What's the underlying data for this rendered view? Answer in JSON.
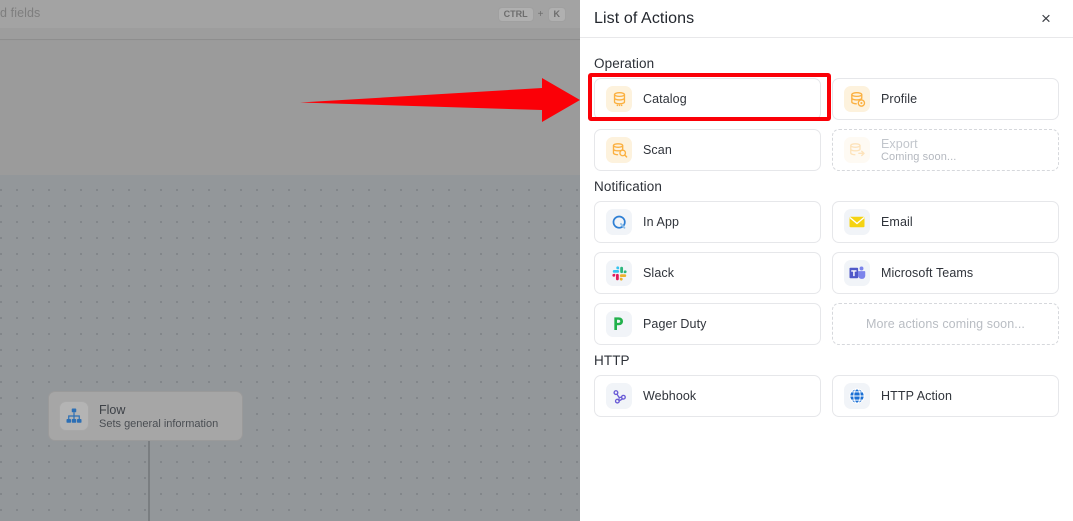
{
  "backdrop": {
    "search_text": "d fields",
    "shortcut": {
      "key1": "CTRL",
      "plus": "+",
      "key2": "K"
    },
    "flow_node": {
      "title": "Flow",
      "subtitle": "Sets general information",
      "icon": "org-chart-icon"
    }
  },
  "annotation": {
    "arrow_color": "#fb0007",
    "highlight_color": "#fb0007",
    "highlight_target": "Catalog"
  },
  "panel": {
    "title": "List of Actions",
    "close_label": "×",
    "sections": [
      {
        "id": "operation",
        "title": "Operation",
        "items": [
          {
            "label": "Catalog",
            "sub": "",
            "icon": "database-icon",
            "icon_style": "icon-amber",
            "state": "highlighted"
          },
          {
            "label": "Profile",
            "sub": "",
            "icon": "database-profile-icon",
            "icon_style": "icon-amber",
            "state": "enabled"
          },
          {
            "label": "Scan",
            "sub": "",
            "icon": "database-search-icon",
            "icon_style": "icon-amber",
            "state": "enabled"
          },
          {
            "label": "Export",
            "sub": "Coming soon...",
            "icon": "database-export-icon",
            "icon_style": "icon-amber",
            "state": "disabled"
          }
        ]
      },
      {
        "id": "notification",
        "title": "Notification",
        "items": [
          {
            "label": "In App",
            "sub": "",
            "icon": "in-app-bell-icon",
            "icon_style": "icon-grayblue",
            "state": "enabled"
          },
          {
            "label": "Email",
            "sub": "",
            "icon": "envelope-icon",
            "icon_style": "icon-grayblue",
            "state": "enabled"
          },
          {
            "label": "Slack",
            "sub": "",
            "icon": "slack-icon",
            "icon_style": "icon-grayblue",
            "state": "enabled"
          },
          {
            "label": "Microsoft Teams",
            "sub": "",
            "icon": "microsoft-teams-icon",
            "icon_style": "icon-grayblue",
            "state": "enabled"
          },
          {
            "label": "Pager Duty",
            "sub": "",
            "icon": "pagerduty-icon",
            "icon_style": "icon-grayblue",
            "state": "enabled"
          },
          {
            "label": "More actions coming soon...",
            "sub": "",
            "icon": "",
            "icon_style": "",
            "state": "placeholder"
          }
        ]
      },
      {
        "id": "http",
        "title": "HTTP",
        "items": [
          {
            "label": "Webhook",
            "sub": "",
            "icon": "webhook-icon",
            "icon_style": "icon-grayblue",
            "state": "enabled"
          },
          {
            "label": "HTTP Action",
            "sub": "",
            "icon": "globe-icon",
            "icon_style": "icon-grayblue",
            "state": "enabled"
          }
        ]
      }
    ]
  },
  "colors": {
    "amber": "#fbb040",
    "amber_bg": "#fdf2dd",
    "blue": "#2e7fd4",
    "purple": "#6a5bd6",
    "teams_purple": "#5059c9",
    "pagerduty_green": "#22b14c",
    "red_annotation": "#fb0007"
  }
}
